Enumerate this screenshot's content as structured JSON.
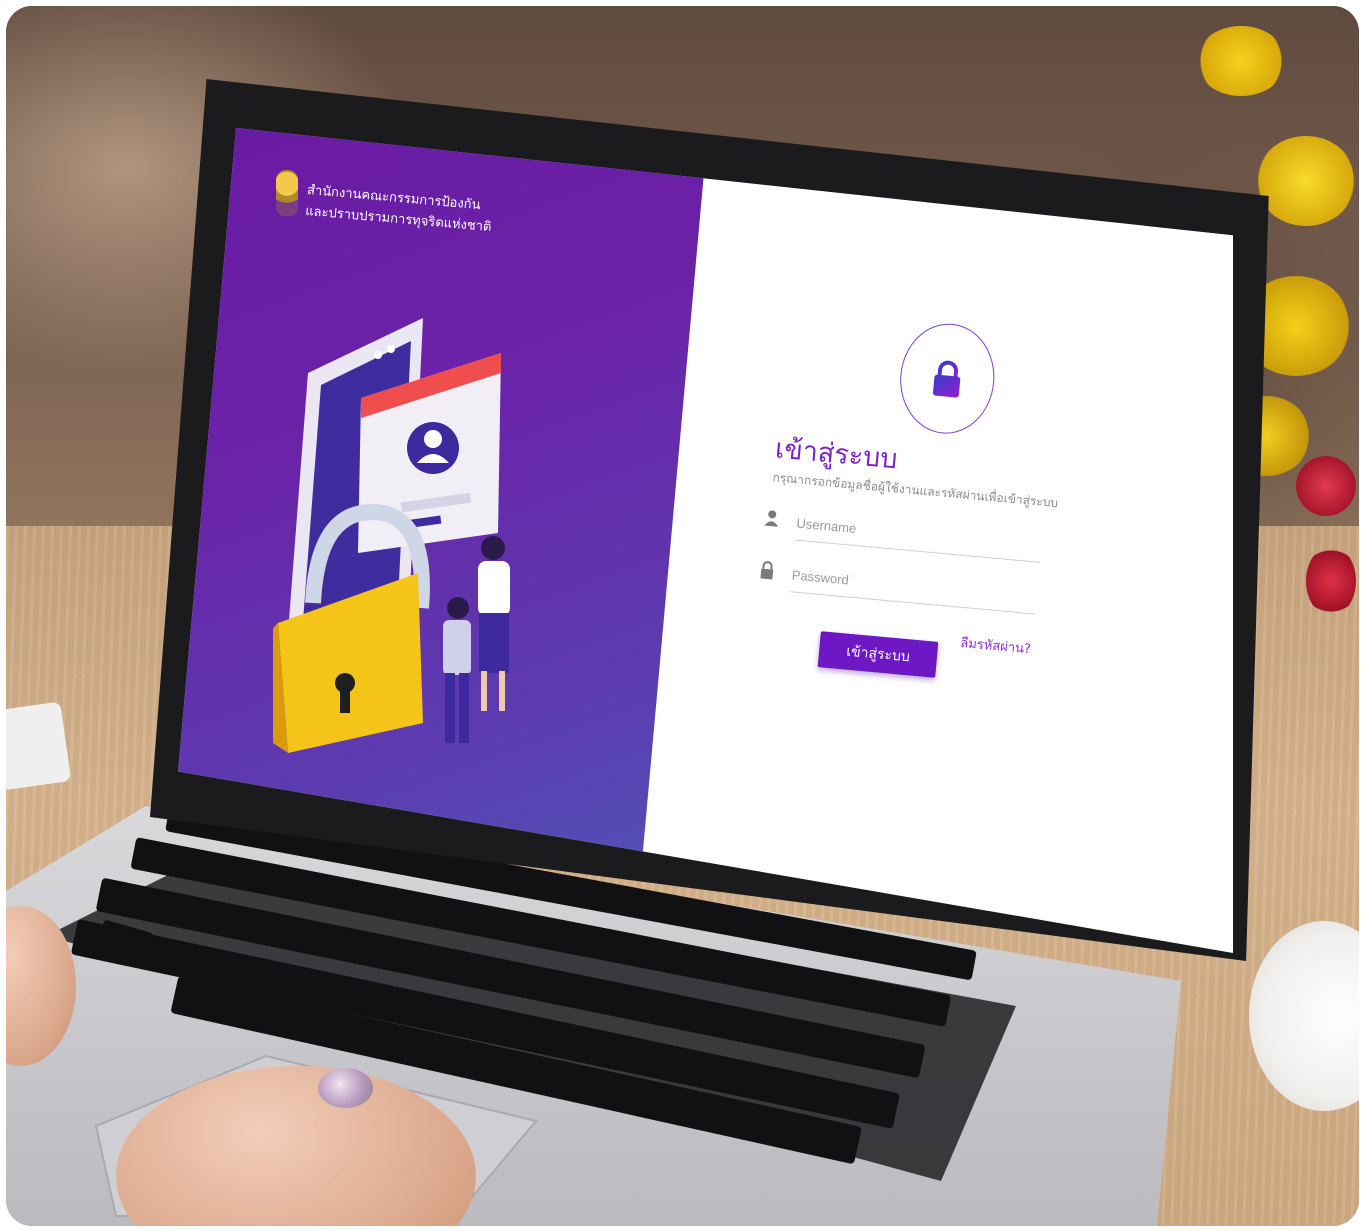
{
  "agency": {
    "line1": "สำนักงานคณะกรรมการป้องกัน",
    "line2": "และปราบปรามการทุจริตแห่งชาติ"
  },
  "login": {
    "title": "เข้าสู่ระบบ",
    "subtitle": "กรุณากรอกข้อมูลชื่อผู้ใช้งานและรหัสผ่านเพื่อเข้าสู่ระบบ",
    "username_placeholder": "Username",
    "password_placeholder": "Password",
    "forgot": "ลืมรหัสผ่าน?",
    "button": "เข้าสู่ระบบ"
  },
  "icons": [
    "lock-icon",
    "user-icon",
    "padlock-icon"
  ],
  "colors": {
    "brand_purple": "#6d17c5",
    "panel_gradient_top": "#6a1aa3",
    "panel_gradient_bottom": "#4d59b8"
  }
}
